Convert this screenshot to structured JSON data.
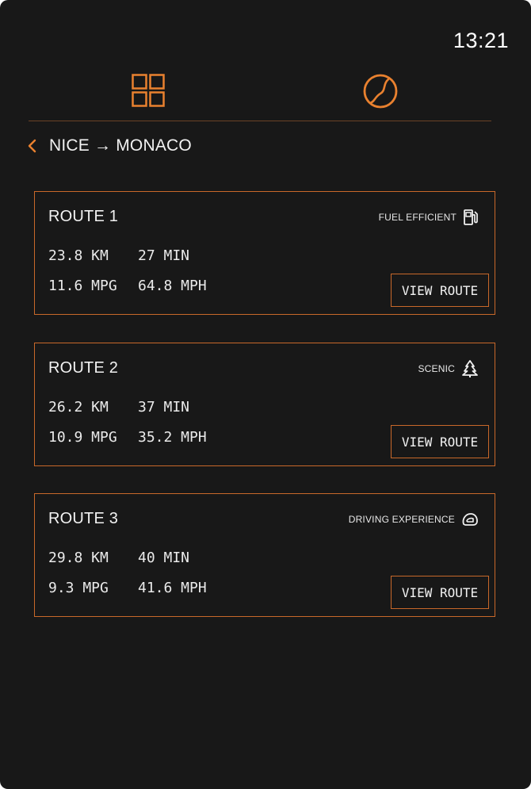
{
  "status": {
    "time": "13:21"
  },
  "nav": {
    "icons": [
      "grid-icon",
      "globe-icon"
    ],
    "accent_color": "#e9812f"
  },
  "breadcrumb": {
    "text": "NICE → MONACO"
  },
  "routes": [
    {
      "title": "ROUTE 1",
      "tag": "FUEL EFFICIENT",
      "tag_icon": "fuel-pump-icon",
      "distance": "23.8 KM",
      "duration": "27 MIN",
      "mpg": "11.6 MPG",
      "speed": "64.8 MPH",
      "button": "VIEW ROUTE"
    },
    {
      "title": "ROUTE 2",
      "tag": "SCENIC",
      "tag_icon": "tree-icon",
      "distance": "26.2 KM",
      "duration": "37 MIN",
      "mpg": "10.9 MPG",
      "speed": "35.2 MPH",
      "button": "VIEW ROUTE"
    },
    {
      "title": "ROUTE 3",
      "tag": "DRIVING EXPERIENCE",
      "tag_icon": "helmet-icon",
      "distance": "29.8 KM",
      "duration": "40 MIN",
      "mpg": "9.3 MPG",
      "speed": "41.6 MPH",
      "button": "VIEW ROUTE"
    }
  ]
}
